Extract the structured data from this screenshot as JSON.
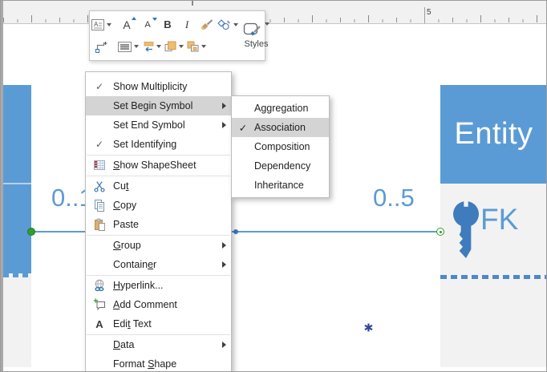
{
  "ruler": {
    "major_label": "5"
  },
  "mini_toolbar": {
    "styles_label": "Styles",
    "glyphs": {
      "grow_font": "A",
      "shrink_font": "A",
      "bold": "B",
      "italic": "I"
    }
  },
  "glyphs": {
    "check": "✓",
    "edit_text_icon": "A"
  },
  "context_menu": {
    "items": [
      {
        "label": "Show Multiplicity",
        "pre": "Show Multiplicity",
        "key": "",
        "post": "",
        "checked": true
      },
      {
        "label": "Set Begin Symbol",
        "pre": "Set Begin Symbol",
        "key": "",
        "post": "",
        "has_submenu": true,
        "highlighted": true
      },
      {
        "label": "Set End Symbol",
        "pre": "Set End Symbol",
        "key": "",
        "post": "",
        "has_submenu": true
      },
      {
        "label": "Set Identifying",
        "pre": "Set Identifying",
        "key": "",
        "post": "",
        "checked": true
      },
      {
        "label": "Show ShapeSheet",
        "pre": "",
        "key": "S",
        "post": "how ShapeSheet",
        "icon": "shapesheet-icon"
      },
      {
        "label": "Cut",
        "pre": "Cu",
        "key": "t",
        "post": "",
        "icon": "cut-icon"
      },
      {
        "label": "Copy",
        "pre": "",
        "key": "C",
        "post": "opy",
        "icon": "copy-icon"
      },
      {
        "label": "Paste",
        "pre": "Paste",
        "key": "",
        "post": "",
        "icon": "paste-icon"
      },
      {
        "label": "Group",
        "pre": "",
        "key": "G",
        "post": "roup",
        "has_submenu": true
      },
      {
        "label": "Container",
        "pre": "Contain",
        "key": "e",
        "post": "r",
        "has_submenu": true
      },
      {
        "label": "Hyperlink...",
        "pre": "",
        "key": "H",
        "post": "yperlink...",
        "icon": "hyperlink-icon"
      },
      {
        "label": "Add Comment",
        "pre": "",
        "key": "A",
        "post": "dd Comment",
        "icon": "add-comment-icon"
      },
      {
        "label": "Edit Text",
        "pre": "Edi",
        "key": "t",
        "post": " Text",
        "icon": "edit-text-icon"
      },
      {
        "label": "Data",
        "pre": "",
        "key": "D",
        "post": "ata",
        "has_submenu": true
      },
      {
        "label": "Format Shape",
        "pre": "Format ",
        "key": "S",
        "post": "hape"
      }
    ]
  },
  "submenu": {
    "items": [
      "Aggregation",
      "Association",
      "Composition",
      "Dependency",
      "Inheritance"
    ],
    "checked_item": "Association",
    "highlighted_item": "Association"
  },
  "canvas": {
    "entity_title": "Entity",
    "foreign_key_label": "FK",
    "multiplicity_begin": "0..1",
    "multiplicity_end": "0..5"
  },
  "colors": {
    "shape_blue": "#5b9bd5",
    "body_gray": "#f2f2f2",
    "connector_blue": "#5b9bd5",
    "endpoint_green": "#2da12d",
    "menu_highlight": "#d4d4d4",
    "key_blue": "#3e7cbd",
    "label_blue": "#5b9bd5"
  }
}
